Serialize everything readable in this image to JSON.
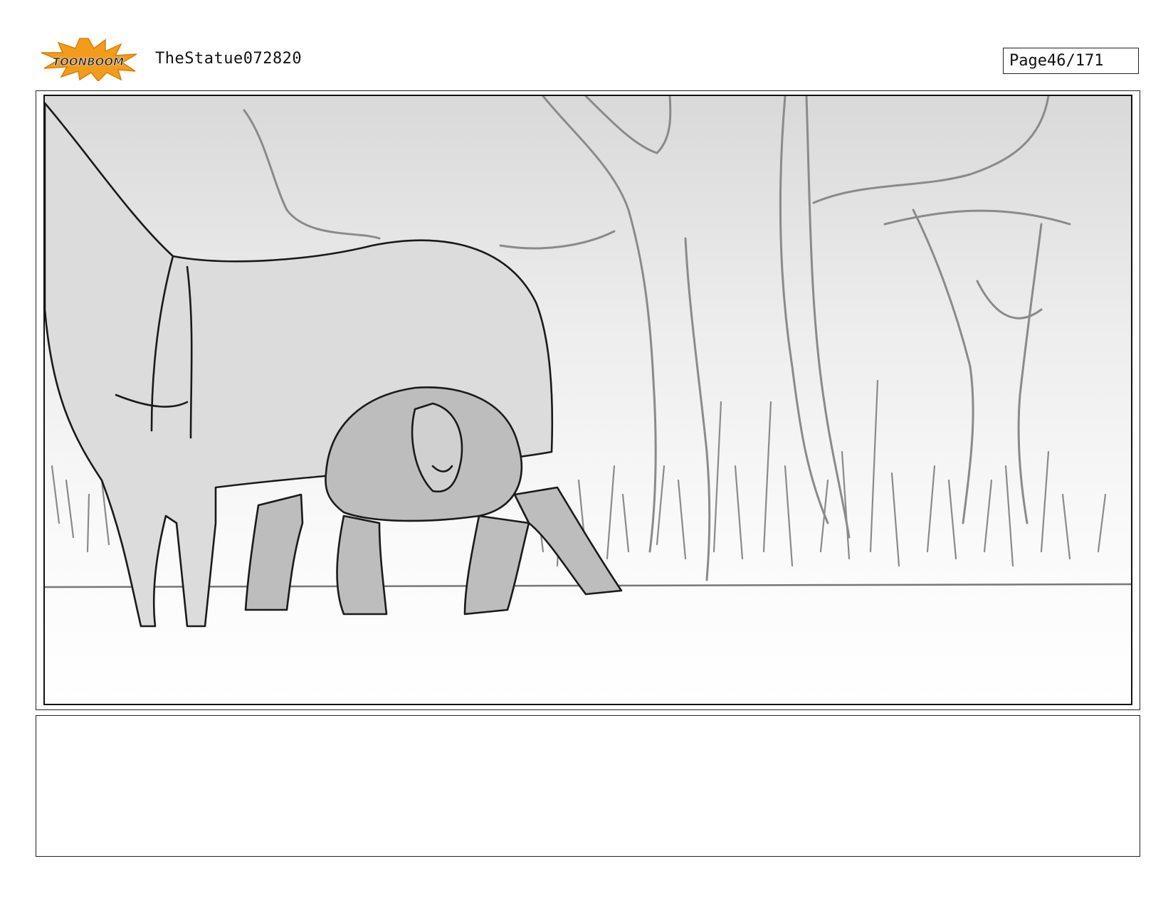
{
  "header": {
    "logo_text": "TOONBOOM",
    "project_title": "TheStatue072820",
    "page_label": "Page",
    "page_number": "46/171"
  },
  "panel": {
    "description_visible": false
  },
  "caption": {
    "text": ""
  },
  "colors": {
    "logo_orange": "#f39c1b",
    "logo_dark": "#2b2b2b",
    "sketch_line": "#1a1a1a",
    "sketch_gray": "#8a8a8a",
    "creature_fill": "#bdbdbd"
  }
}
